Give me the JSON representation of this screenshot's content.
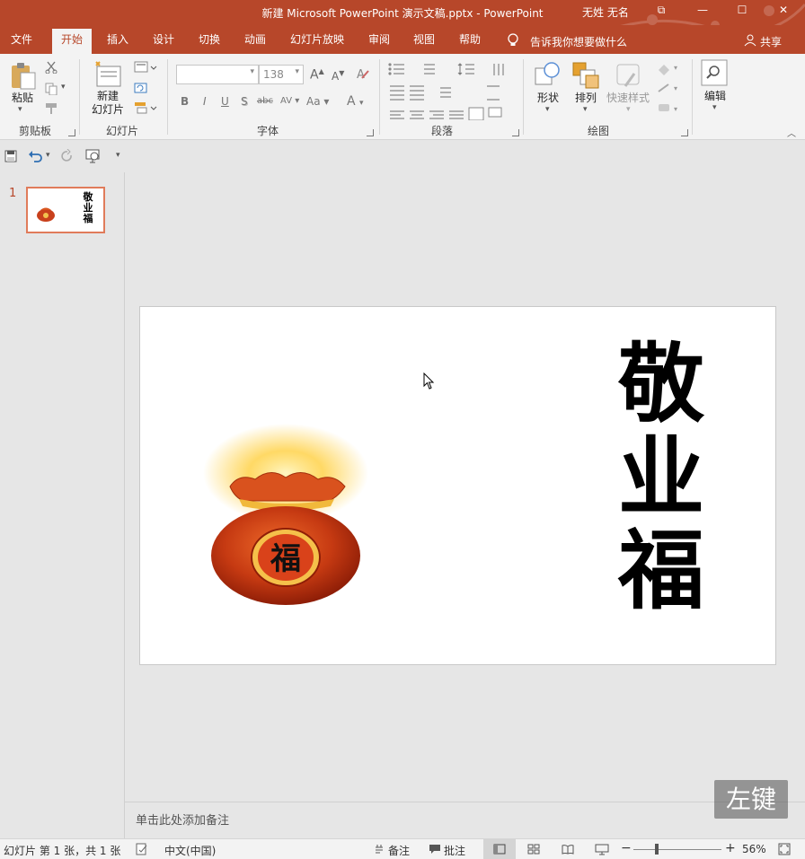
{
  "window": {
    "title": "新建 Microsoft PowerPoint 演示文稿.pptx  -  PowerPoint",
    "user": "无姓 无名",
    "controls": [
      "⧉",
      "—",
      "☐",
      "✕"
    ]
  },
  "tabs": [
    {
      "label": "文件",
      "active": false
    },
    {
      "label": "开始",
      "active": true
    },
    {
      "label": "插入",
      "active": false
    },
    {
      "label": "设计",
      "active": false
    },
    {
      "label": "切换",
      "active": false
    },
    {
      "label": "动画",
      "active": false
    },
    {
      "label": "幻灯片放映",
      "active": false
    },
    {
      "label": "审阅",
      "active": false
    },
    {
      "label": "视图",
      "active": false
    },
    {
      "label": "帮助",
      "active": false
    }
  ],
  "tell_me": "告诉我你想要做什么",
  "share": "共享",
  "ribbon": {
    "clipboard": {
      "paste": "粘贴",
      "group": "剪贴板"
    },
    "slides": {
      "new_slide": "新建\n幻灯片",
      "group": "幻灯片"
    },
    "font": {
      "font_size": "138",
      "group": "字体",
      "bold": "B",
      "italic": "I",
      "underline": "U",
      "shadow": "S",
      "strike": "abc",
      "spacing": "AV",
      "case": "Aa",
      "color": "A"
    },
    "paragraph": {
      "group": "段落"
    },
    "drawing": {
      "shapes": "形状",
      "arrange": "排列",
      "quick_styles": "快速样式",
      "group": "绘图"
    },
    "editing": {
      "label": "编辑"
    }
  },
  "slides_pane": {
    "slide_number": "1"
  },
  "slide": {
    "vertical_text": "敬业福",
    "bag_char": "福"
  },
  "notes_placeholder": "单击此处添加备注",
  "watermark": "左键",
  "status": {
    "slide_info": "幻灯片 第 1 张，共 1 张",
    "language": "中文(中国)",
    "notes": "备注",
    "comments": "批注",
    "zoom": "56%"
  },
  "colors": {
    "accent": "#b7472a",
    "ribbon_bg": "#f3f3f3",
    "workspace": "#e6e6e6"
  }
}
